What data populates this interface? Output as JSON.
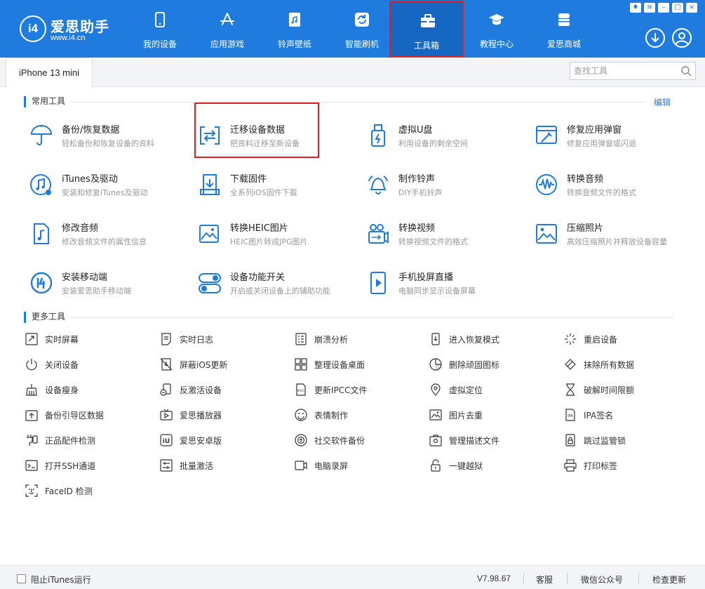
{
  "app": {
    "logo_mark": "i4",
    "name": "爱思助手",
    "url": "www.i4.cn"
  },
  "nav": [
    {
      "label": "我的设备",
      "icon": "phone-icon"
    },
    {
      "label": "应用游戏",
      "icon": "app-store-icon"
    },
    {
      "label": "铃声壁纸",
      "icon": "music-file-icon"
    },
    {
      "label": "智能刷机",
      "icon": "refresh-icon"
    },
    {
      "label": "工具箱",
      "icon": "toolbox-icon",
      "active": true
    },
    {
      "label": "教程中心",
      "icon": "graduation-cap-icon"
    },
    {
      "label": "爱思商城",
      "icon": "shop-icon"
    }
  ],
  "tabbar": {
    "device_tab": "iPhone 13 mini",
    "search_placeholder": "查找工具"
  },
  "common": {
    "title": "常用工具",
    "edit": "编辑",
    "tools": [
      {
        "title": "备份/恢复数据",
        "desc": "轻松备份和恢复设备的资料",
        "icon": "umbrella-icon"
      },
      {
        "title": "迁移设备数据",
        "desc": "把资料迁移至新设备",
        "icon": "transfer-icon"
      },
      {
        "title": "虚拟U盘",
        "desc": "利用设备的剩余空间",
        "icon": "usb-drive-icon"
      },
      {
        "title": "修复应用弹窗",
        "desc": "修复应用弹窗或闪退",
        "icon": "repair-window-icon"
      },
      {
        "title": "iTunes及驱动",
        "desc": "安装和修复iTunes及驱动",
        "icon": "itunes-icon"
      },
      {
        "title": "下载固件",
        "desc": "全系列iOS固件下载",
        "icon": "download-firmware-icon"
      },
      {
        "title": "制作铃声",
        "desc": "DIY手机铃声",
        "icon": "bell-icon"
      },
      {
        "title": "转换音频",
        "desc": "转换音频文件的格式",
        "icon": "audio-wave-icon"
      },
      {
        "title": "修改音频",
        "desc": "修改音频文件的属性信息",
        "icon": "audio-file-icon"
      },
      {
        "title": "转换HEIC图片",
        "desc": "HEIC图片转成JPG图片",
        "icon": "heic-image-icon"
      },
      {
        "title": "转换视频",
        "desc": "转换视频文件的格式",
        "icon": "video-convert-icon"
      },
      {
        "title": "压缩照片",
        "desc": "高效压缩照片并释放设备容量",
        "icon": "photo-icon"
      },
      {
        "title": "安装移动端",
        "desc": "安装爱思助手移动端",
        "icon": "i4-mobile-icon"
      },
      {
        "title": "设备功能开关",
        "desc": "开启或关闭设备上的辅助功能",
        "icon": "toggle-icon"
      },
      {
        "title": "手机投屏直播",
        "desc": "电脑同步显示设备屏幕",
        "icon": "screen-mirror-icon"
      }
    ]
  },
  "more": {
    "title": "更多工具",
    "tools": [
      {
        "label": "实时屏幕",
        "icon": "realtime-screen-icon"
      },
      {
        "label": "实时日志",
        "icon": "log-icon"
      },
      {
        "label": "崩溃分析",
        "icon": "crash-analysis-icon"
      },
      {
        "label": "进入恢复模式",
        "icon": "recovery-mode-icon"
      },
      {
        "label": "重启设备",
        "icon": "restart-icon"
      },
      {
        "label": "关闭设备",
        "icon": "power-icon"
      },
      {
        "label": "屏蔽iOS更新",
        "icon": "block-update-icon"
      },
      {
        "label": "整理设备桌面",
        "icon": "grid-icon"
      },
      {
        "label": "删除顽固图标",
        "icon": "delete-icon-icon"
      },
      {
        "label": "抹除所有数据",
        "icon": "eraser-icon"
      },
      {
        "label": "设备瘦身",
        "icon": "broom-icon"
      },
      {
        "label": "反激活设备",
        "icon": "deactivate-icon"
      },
      {
        "label": "更新IPCC文件",
        "icon": "ipcc-file-icon"
      },
      {
        "label": "虚拟定位",
        "icon": "location-pin-icon"
      },
      {
        "label": "破解时间限额",
        "icon": "hourglass-icon"
      },
      {
        "label": "备份引导区数据",
        "icon": "backup-boot-icon"
      },
      {
        "label": "爱思播放器",
        "icon": "tv-player-icon"
      },
      {
        "label": "表情制作",
        "icon": "smiley-icon"
      },
      {
        "label": "图片去重",
        "icon": "image-dedupe-icon"
      },
      {
        "label": "IPA签名",
        "icon": "ipa-sign-icon"
      },
      {
        "label": "正品配件检测",
        "icon": "cable-check-icon"
      },
      {
        "label": "爱思安卓版",
        "icon": "i4-android-icon"
      },
      {
        "label": "社交软件备份",
        "icon": "social-backup-icon"
      },
      {
        "label": "管理描述文件",
        "icon": "profile-manage-icon"
      },
      {
        "label": "跳过监管锁",
        "icon": "skip-lock-icon"
      },
      {
        "label": "打开SSH通道",
        "icon": "terminal-icon"
      },
      {
        "label": "批量激活",
        "icon": "batch-activate-icon"
      },
      {
        "label": "电脑录屏",
        "icon": "screen-record-icon"
      },
      {
        "label": "一键越狱",
        "icon": "jailbreak-lock-icon"
      },
      {
        "label": "打印标签",
        "icon": "printer-icon"
      },
      {
        "label": "FaceID 检测",
        "icon": "faceid-icon"
      }
    ]
  },
  "footer": {
    "itunes_block": "阻止iTunes运行",
    "version": "V7.98.67",
    "service": "客服",
    "wechat": "微信公众号",
    "update": "检查更新"
  },
  "colors": {
    "brand": "#1f7cde",
    "highlight": "#e02020"
  }
}
